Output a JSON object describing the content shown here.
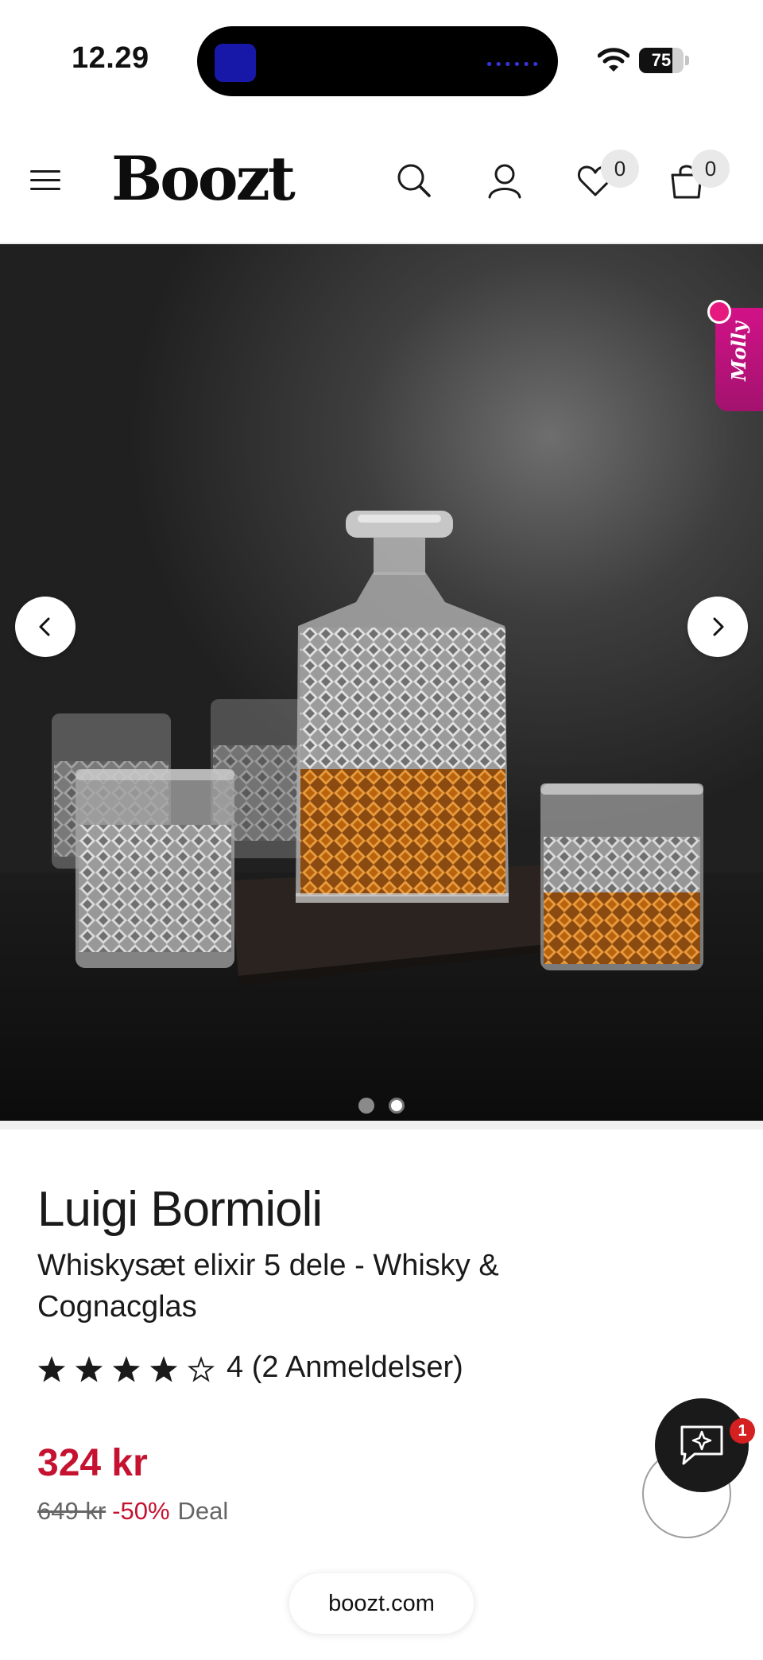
{
  "status_bar": {
    "time": "12.29",
    "battery_level": 75,
    "battery_label": "75",
    "island_dots": "••••••"
  },
  "header": {
    "logo": "Boozt",
    "wishlist_count": "0",
    "cart_count": "0",
    "icons": [
      "menu-icon",
      "search-icon",
      "account-icon",
      "heart-icon",
      "bag-icon"
    ]
  },
  "hero": {
    "molly_label": "Molly",
    "slide_count": 2,
    "active_slide": 2,
    "colors": {
      "dot_inactive": "#8a8a8a",
      "dot_active": "#ffffff"
    }
  },
  "product": {
    "brand": "Luigi Bormioli",
    "title": "Whiskysæt elixir 5 dele - Whisky & Cognacglas",
    "rating": 4,
    "rating_max": 5,
    "rating_text": "4 (2 Anmeldelser)",
    "price": "324 kr",
    "old_price": "649 kr",
    "discount": "-50%",
    "deal_label": "Deal"
  },
  "chat": {
    "badge": "1"
  },
  "browser": {
    "url": "boozt.com"
  },
  "colors": {
    "price_red": "#c41230",
    "molly_pink": "#d11287",
    "text": "#1a1a1a"
  }
}
